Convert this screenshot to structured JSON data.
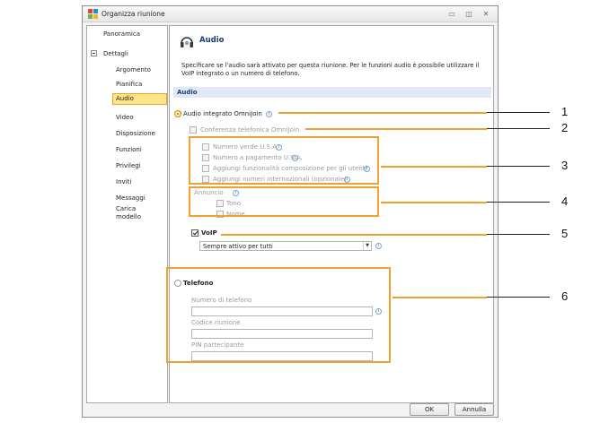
{
  "window": {
    "title": "Organizza riunione"
  },
  "nav": {
    "items": [
      {
        "label": "Panoramica"
      },
      {
        "label": "Dettagli"
      },
      {
        "label": "Argomento"
      },
      {
        "label": "Pianifica"
      },
      {
        "label": "Audio",
        "selected": true
      },
      {
        "label": "Video"
      },
      {
        "label": "Disposizione"
      },
      {
        "label": "Funzioni"
      },
      {
        "label": "Privilegi"
      },
      {
        "label": "Inviti"
      },
      {
        "label": "Messaggi"
      },
      {
        "label": "Carica\nmodello"
      }
    ]
  },
  "content": {
    "header_title": "Audio",
    "description": "Specificare se l'audio sarà attivato per questa riunione.  Per le funzioni audio è possibile utilizzare il VoIP integrato o un numero di telefono.",
    "section_title": "Audio",
    "integrated_audio": {
      "label": "Audio integrato OmniJoin",
      "selected": true
    },
    "conference": {
      "label": "Conferenza telefonica OmniJoin"
    },
    "phone_options": [
      "Numero verde U.S.A.",
      "Numero a pagamento U.S.A.",
      "Aggiungi funzionalità composizione per gli utenti",
      "Aggiungi numeri internazionali (opzionale)"
    ],
    "announcement": {
      "label": "Annuncio",
      "options": [
        "Tono",
        "Nome"
      ]
    },
    "voip": {
      "label": "VoIP",
      "checked": true,
      "mode": "Sempre attivo per tutti"
    },
    "phone": {
      "label": "Telefono",
      "fields": [
        {
          "label": "Numero di telefono",
          "value": ""
        },
        {
          "label": "Codice riunione",
          "value": ""
        },
        {
          "label": "PIN partecipante",
          "value": ""
        }
      ]
    }
  },
  "buttons": {
    "ok": "OK",
    "cancel": "Annulla"
  },
  "callouts": [
    "1",
    "2",
    "3",
    "4",
    "5",
    "6"
  ],
  "colors": {
    "callout_orange": "#f0a030",
    "selection_yellow": "#ffe48a",
    "header_blue": "#1b3f7a"
  }
}
